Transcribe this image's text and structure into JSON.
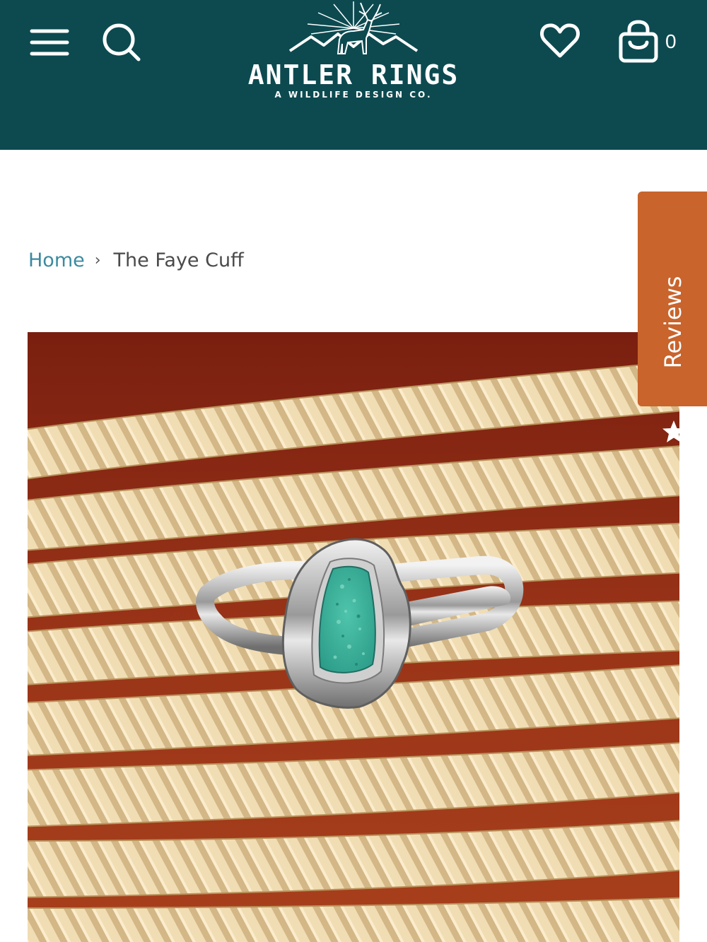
{
  "header": {
    "background": "#0c4a50",
    "menu_icon": "hamburger-menu-icon",
    "search_icon": "search-icon",
    "wishlist_icon": "heart-icon",
    "cart_icon": "shopping-bag-icon",
    "cart_count": "0"
  },
  "logo": {
    "title": "ANTLER RINGS",
    "subtitle": "A WILDLIFE DESIGN CO.",
    "art": "elk-mountains-sunburst"
  },
  "breadcrumb": {
    "home": "Home",
    "separator": "›",
    "current": "The Faye Cuff"
  },
  "reviews_tab": {
    "label": "Reviews",
    "icon": "star-icon",
    "color": "#c8642c"
  },
  "product": {
    "image_subject": "silver cuff with turquoise stone on coiled rope"
  },
  "colors": {
    "link": "#3b8aa0",
    "text": "#4a4a4a"
  }
}
